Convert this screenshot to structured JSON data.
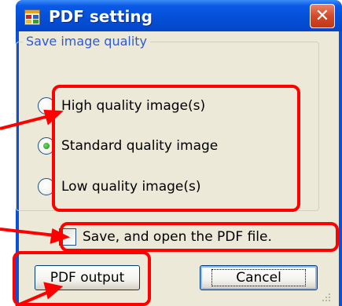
{
  "window": {
    "title": "PDF setting",
    "close_glyph": "✕",
    "icon_name": "app-window-icon",
    "close_icon_name": "close-icon"
  },
  "quality_group": {
    "label": "Save image quality",
    "options": [
      {
        "label": "High quality image(s)",
        "selected": false
      },
      {
        "label": "Standard quality image",
        "selected": true
      },
      {
        "label": "Low quality image(s)",
        "selected": false
      }
    ]
  },
  "open_after_save": {
    "label": "Save, and open the PDF file.",
    "checked": false
  },
  "buttons": {
    "pdf_output": "PDF output",
    "cancel": "Cancel"
  },
  "annotation": {
    "highlight_color": "#ff0000"
  },
  "colors": {
    "titlebar": "#0450d8",
    "client": "#ece9d8",
    "group_label": "#2a5ad8"
  }
}
